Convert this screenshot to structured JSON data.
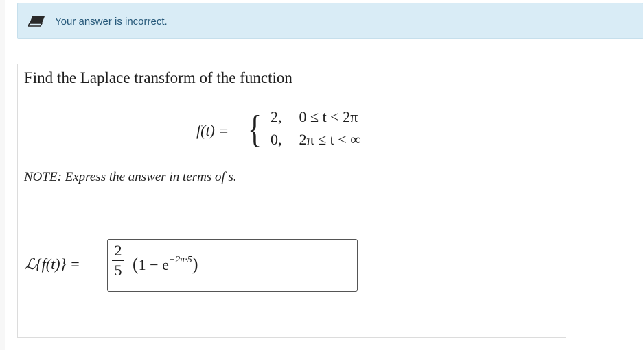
{
  "alert": {
    "message": "Your answer is incorrect.",
    "icon": "pencil-eraser-icon"
  },
  "question": {
    "prompt": "Find the Laplace transform of the function",
    "function_lhs": "f(t) =",
    "cases": [
      {
        "value": "2,",
        "condition": "0 ≤ t < 2π"
      },
      {
        "value": "0,",
        "condition": "2π ≤ t < ∞"
      }
    ],
    "note": "NOTE: Express the answer in terms of s."
  },
  "answer": {
    "lhs": "ℒ{f(t)} =",
    "fraction_numerator": "2",
    "fraction_denominator": "5",
    "open_paren": "(",
    "body": "1 − e",
    "exponent": "−2π·5",
    "close_paren": ")"
  }
}
